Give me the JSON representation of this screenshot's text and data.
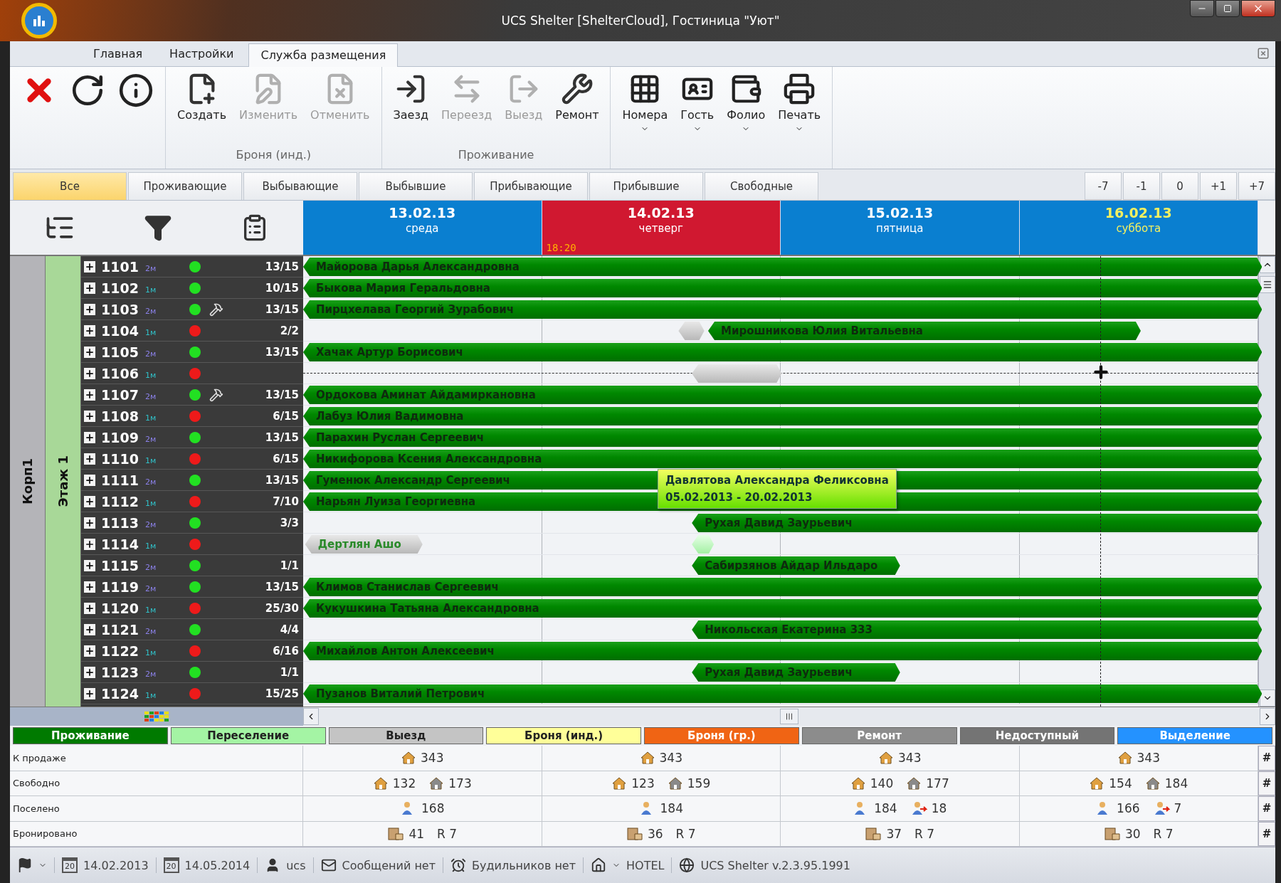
{
  "window": {
    "title": "UCS Shelter [ShelterCloud], Гостиница \"Уют\""
  },
  "ribbon_tabs": [
    {
      "label": "Главная",
      "selected": false
    },
    {
      "label": "Настройки",
      "selected": false
    },
    {
      "label": "Служба размещения",
      "selected": true
    }
  ],
  "ribbon_groups": [
    {
      "buttons": [
        {
          "disabled": false
        },
        {
          "disabled": false
        },
        {
          "disabled": false
        }
      ]
    },
    {
      "label": "Броня (инд.)",
      "buttons": [
        {
          "label": "Создать",
          "disabled": false
        },
        {
          "label": "Изменить",
          "disabled": true
        },
        {
          "label": "Отменить",
          "disabled": true
        }
      ]
    },
    {
      "label": "Проживание",
      "buttons": [
        {
          "label": "Заезд",
          "disabled": false
        },
        {
          "label": "Переезд",
          "disabled": true
        },
        {
          "label": "Выезд",
          "disabled": true
        },
        {
          "label": "Ремонт",
          "disabled": false
        }
      ]
    },
    {
      "buttons": [
        {
          "label": "Номера",
          "disabled": false,
          "dropdown": true
        },
        {
          "label": "Гость",
          "disabled": false,
          "dropdown": true
        },
        {
          "label": "Фолио",
          "disabled": false,
          "dropdown": true
        },
        {
          "label": "Печать",
          "disabled": false,
          "dropdown": true
        }
      ]
    }
  ],
  "filter_tabs": [
    {
      "label": "Все",
      "selected": true
    },
    {
      "label": "Проживающие",
      "selected": false
    },
    {
      "label": "Выбывающие",
      "selected": false
    },
    {
      "label": "Выбывшие",
      "selected": false
    },
    {
      "label": "Прибывающие",
      "selected": false
    },
    {
      "label": "Прибывшие",
      "selected": false
    },
    {
      "label": "Свободные",
      "selected": false
    }
  ],
  "day_shift_buttons": [
    "-7",
    "-1",
    "0",
    "+1",
    "+7"
  ],
  "days": [
    {
      "date": "13.02.13",
      "weekday": "среда",
      "today": false,
      "weekend": false
    },
    {
      "date": "14.02.13",
      "weekday": "четверг",
      "today": true,
      "weekend": false,
      "time": "18:20"
    },
    {
      "date": "15.02.13",
      "weekday": "пятница",
      "today": false,
      "weekend": false
    },
    {
      "date": "16.02.13",
      "weekday": "суббота",
      "today": false,
      "weekend": true
    }
  ],
  "building": "Корп1",
  "floor": "Этаж 1",
  "rooms": [
    {
      "number": "1101",
      "type": {
        "text": "2м",
        "color": "#8a80e8"
      },
      "color": "#22e022",
      "repair": false,
      "occupancy": "13/15",
      "hover": false,
      "bars": [
        {
          "kind": "stay",
          "label": "Майорова Дарья Александровна"
        }
      ]
    },
    {
      "number": "1102",
      "type": {
        "text": "1м",
        "color": "#30c0c8"
      },
      "color": "#22e022",
      "repair": false,
      "occupancy": "10/15",
      "hover": false,
      "bars": [
        {
          "kind": "stay",
          "label": "Быкова Мария Геральдовна"
        }
      ]
    },
    {
      "number": "1103",
      "type": {
        "text": "2м",
        "color": "#8a80e8"
      },
      "color": "#22e022",
      "repair": true,
      "occupancy": "13/15",
      "hover": false,
      "bars": [
        {
          "kind": "stay",
          "label": "Пирцхелава Георгий Зурабович"
        }
      ]
    },
    {
      "number": "1104",
      "type": {
        "text": "1м",
        "color": "#30c0c8"
      },
      "color": "#ee1a1a",
      "repair": false,
      "occupancy": "2/2",
      "hover": false,
      "bars": [
        {
          "kind": "checkout_mark"
        },
        {
          "kind": "arrival_long",
          "label": "Мирошникова Юлия Витальевна"
        }
      ]
    },
    {
      "number": "1105",
      "type": {
        "text": "2м",
        "color": "#8a80e8"
      },
      "color": "#22e022",
      "repair": false,
      "occupancy": "13/15",
      "hover": false,
      "bars": [
        {
          "kind": "stay",
          "label": "Хачак Артур Борисович"
        }
      ]
    },
    {
      "number": "1106",
      "type": {
        "text": "1м",
        "color": "#30c0c8"
      },
      "color": "#ee1a1a",
      "repair": false,
      "hover": true,
      "bars": [
        {
          "kind": "checkout_day"
        }
      ]
    },
    {
      "number": "1107",
      "type": {
        "text": "2м",
        "color": "#8a80e8"
      },
      "color": "#22e022",
      "repair": true,
      "occupancy": "13/15",
      "hover": false,
      "bars": [
        {
          "kind": "stay",
          "label": "Ордокова Аминат Айдамиркановна"
        }
      ]
    },
    {
      "number": "1108",
      "type": {
        "text": "1м",
        "color": "#30c0c8"
      },
      "color": "#ee1a1a",
      "repair": false,
      "occupancy": "6/15",
      "hover": false,
      "bars": [
        {
          "kind": "stay",
          "label": "Лабуз Юлия Вадимовна"
        }
      ]
    },
    {
      "number": "1109",
      "type": {
        "text": "2м",
        "color": "#8a80e8"
      },
      "color": "#22e022",
      "repair": false,
      "occupancy": "13/15",
      "hover": false,
      "bars": [
        {
          "kind": "stay",
          "label": "Парахин Руслан Сергеевич"
        }
      ]
    },
    {
      "number": "1110",
      "type": {
        "text": "1м",
        "color": "#30c0c8"
      },
      "color": "#ee1a1a",
      "repair": false,
      "occupancy": "6/15",
      "hover": false,
      "bars": [
        {
          "kind": "stay",
          "label": "Никифорова Ксения Александровна"
        }
      ]
    },
    {
      "number": "1111",
      "type": {
        "text": "2м",
        "color": "#8a80e8"
      },
      "color": "#22e022",
      "repair": false,
      "occupancy": "13/15",
      "hover": false,
      "bars": [
        {
          "kind": "stay",
          "label": "Гуменюк Александр Сергеевич"
        }
      ]
    },
    {
      "number": "1112",
      "type": {
        "text": "1м",
        "color": "#30c0c8"
      },
      "color": "#ee1a1a",
      "repair": false,
      "occupancy": "7/10",
      "hover": false,
      "bars": [
        {
          "kind": "stay",
          "label": "Нарьян Луиза Георгиевна"
        }
      ]
    },
    {
      "number": "1113",
      "type": {
        "text": "2м",
        "color": "#8a80e8"
      },
      "color": "#22e022",
      "repair": false,
      "occupancy": "3/3",
      "hover": false,
      "bars": [
        {
          "kind": "arrival",
          "label": "Рухая Давид Заурьевич"
        }
      ]
    },
    {
      "number": "1114",
      "type": {
        "text": "1м",
        "color": "#30c0c8"
      },
      "color": "#ee1a1a",
      "repair": false,
      "hover": false,
      "bars": [
        {
          "kind": "checkout_early",
          "label": "Дертлян Ашо"
        },
        {
          "kind": "transfer_mark"
        }
      ]
    },
    {
      "number": "1115",
      "type": {
        "text": "2м",
        "color": "#8a80e8"
      },
      "color": "#22e022",
      "repair": false,
      "occupancy": "1/1",
      "hover": false,
      "bars": [
        {
          "kind": "arrival_short",
          "label": "Сабирзянов Айдар Ильдаро"
        }
      ]
    },
    {
      "number": "1119",
      "type": {
        "text": "2м",
        "color": "#8a80e8"
      },
      "color": "#22e022",
      "repair": false,
      "occupancy": "13/15",
      "hover": false,
      "bars": [
        {
          "kind": "stay",
          "label": "Климов Станислав Сергеевич"
        }
      ]
    },
    {
      "number": "1120",
      "type": {
        "text": "1м",
        "color": "#30c0c8"
      },
      "color": "#ee1a1a",
      "repair": false,
      "occupancy": "25/30",
      "hover": false,
      "bars": [
        {
          "kind": "stay",
          "label": "Кукушкина Татьяна Александровна"
        }
      ]
    },
    {
      "number": "1121",
      "type": {
        "text": "2м",
        "color": "#8a80e8"
      },
      "color": "#22e022",
      "repair": false,
      "occupancy": "4/4",
      "hover": false,
      "bars": [
        {
          "kind": "arrival",
          "label": "Никольская Екатерина 333"
        }
      ]
    },
    {
      "number": "1122",
      "type": {
        "text": "1м",
        "color": "#30c0c8"
      },
      "color": "#ee1a1a",
      "repair": false,
      "occupancy": "6/16",
      "hover": false,
      "bars": [
        {
          "kind": "stay",
          "label": "Михайлов Антон Алексеевич"
        }
      ]
    },
    {
      "number": "1123",
      "type": {
        "text": "2м",
        "color": "#8a80e8"
      },
      "color": "#22e022",
      "repair": false,
      "occupancy": "1/1",
      "hover": false,
      "bars": [
        {
          "kind": "arrival_short",
          "label": "Рухая Давид Заурьевич"
        }
      ]
    },
    {
      "number": "1124",
      "type": {
        "text": "1м",
        "color": "#30c0c8"
      },
      "color": "#ee1a1a",
      "repair": false,
      "occupancy": "15/25",
      "hover": false,
      "bars": [
        {
          "kind": "stay",
          "label": "Пузанов Виталий Петрович"
        }
      ]
    }
  ],
  "tooltip": {
    "name": "Давлятова Александра Феликсовна",
    "dates": "05.02.2013 - 20.02.2013"
  },
  "legend": [
    {
      "label": "Проживание",
      "color": "#007a00"
    },
    {
      "label": "Переселение",
      "color": "#a4f4a4"
    },
    {
      "label": "Выезд",
      "color": "#c4c4c4"
    },
    {
      "label": "Броня (инд.)",
      "color": "#ffff99"
    },
    {
      "label": "Броня (гр.)",
      "color": "#f06414"
    },
    {
      "label": "Ремонт",
      "color": "#8c8c8c"
    },
    {
      "label": "Недоступный",
      "color": "#747474"
    },
    {
      "label": "Выделение",
      "color": "#2492ff"
    }
  ],
  "stats": [
    {
      "label": "К продаже",
      "button": "#",
      "cells": [
        [
          {
            "kind": "house",
            "value": "343"
          }
        ],
        [
          {
            "kind": "house",
            "value": "343"
          }
        ],
        [
          {
            "kind": "house",
            "value": "343"
          }
        ],
        [
          {
            "kind": "house",
            "value": "343"
          }
        ]
      ]
    },
    {
      "label": "Свободно",
      "button": "#",
      "cells": [
        [
          {
            "kind": "house",
            "value": "132"
          },
          {
            "kind": "house_grey",
            "value": "173"
          }
        ],
        [
          {
            "kind": "house",
            "value": "123"
          },
          {
            "kind": "house_grey",
            "value": "159"
          }
        ],
        [
          {
            "kind": "house",
            "value": "140"
          },
          {
            "kind": "house_grey",
            "value": "177"
          }
        ],
        [
          {
            "kind": "house",
            "value": "154"
          },
          {
            "kind": "house_grey",
            "value": "184"
          }
        ]
      ]
    },
    {
      "label": "Поселено",
      "button": "#",
      "cells": [
        [
          {
            "kind": "guest",
            "value": "168"
          }
        ],
        [
          {
            "kind": "guest",
            "value": "184"
          }
        ],
        [
          {
            "kind": "guest",
            "value": "184"
          },
          {
            "kind": "guest_move",
            "value": "18"
          }
        ],
        [
          {
            "kind": "guest",
            "value": "166"
          },
          {
            "kind": "guest_move",
            "value": "7"
          }
        ]
      ]
    },
    {
      "label": "Бронировано",
      "button": "#",
      "cells": [
        [
          {
            "kind": "booking",
            "value": "41"
          },
          {
            "kind": "plain",
            "value": "R 7"
          }
        ],
        [
          {
            "kind": "booking",
            "value": "36"
          },
          {
            "kind": "plain",
            "value": "R 7"
          }
        ],
        [
          {
            "kind": "booking",
            "value": "37"
          },
          {
            "kind": "plain",
            "value": "R 7"
          }
        ],
        [
          {
            "kind": "booking",
            "value": "30"
          },
          {
            "kind": "plain",
            "value": "R 7"
          }
        ]
      ]
    }
  ],
  "status_bar": {
    "date_from": {
      "icon_day": "20",
      "value": "14.02.2013"
    },
    "date_to": {
      "icon_day": "20",
      "value": "14.05.2014"
    },
    "user": "ucs",
    "messages": "Сообщений нет",
    "alarms": "Будильников нет",
    "hotel": "HOTEL",
    "version": "UCS Shelter v.2.3.95.1991"
  }
}
